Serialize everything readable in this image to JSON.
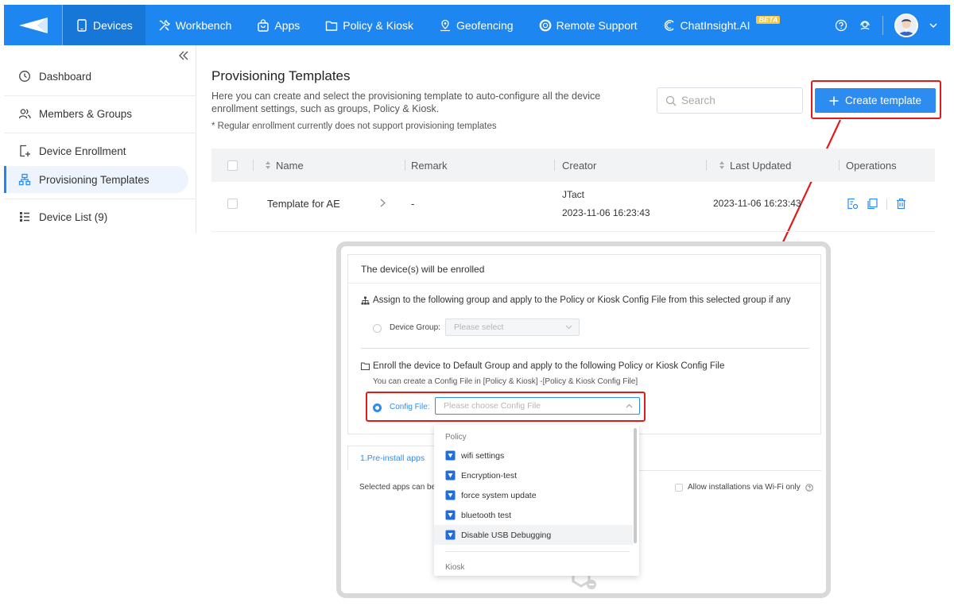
{
  "nav": {
    "items": [
      {
        "label": "Devices",
        "icon": "tablet-icon",
        "active": true
      },
      {
        "label": "Workbench",
        "icon": "tools-icon"
      },
      {
        "label": "Apps",
        "icon": "bag-icon"
      },
      {
        "label": "Policy & Kiosk",
        "icon": "folder-icon"
      },
      {
        "label": "Geofencing",
        "icon": "location-icon"
      },
      {
        "label": "Remote Support",
        "icon": "lifebuoy-icon"
      },
      {
        "label": "ChatInsight.AI",
        "icon": "chat-ai-icon"
      }
    ],
    "beta_badge": "BETA",
    "colors": {
      "bar": "#1e86f0",
      "active": "#1677d9"
    }
  },
  "sidebar": {
    "items": [
      {
        "label": "Dashboard",
        "icon": "dashboard-icon"
      },
      {
        "label": "Members & Groups",
        "icon": "members-icon"
      },
      {
        "label": "Device Enrollment",
        "icon": "enrollment-icon"
      },
      {
        "label": "Provisioning Templates",
        "icon": "templates-icon",
        "active": true
      },
      {
        "label": "Device List (9)",
        "icon": "list-icon"
      }
    ]
  },
  "main": {
    "title": "Provisioning Templates",
    "description": "Here you can create and select the provisioning template to auto-configure all the device enrollment settings, such as groups, Policy & Kiosk.",
    "note": "* Regular enrollment currently does not support provisioning templates",
    "search_placeholder": "Search",
    "create_label": "Create template",
    "columns": [
      "Name",
      "Remark",
      "Creator",
      "Last Updated",
      "Operations"
    ],
    "rows": [
      {
        "name": "Template for AE",
        "remark": "-",
        "creator": "JTact",
        "created": "2023-11-06 16:23:43",
        "updated": "2023-11-06 16:23:43"
      }
    ]
  },
  "zoom": {
    "section_title": "The device(s) will be enrolled",
    "assign_text": "Assign to the following group and apply to the Policy or Kiosk Config File from this selected group if any",
    "device_group_label": "Device Group:",
    "device_group_placeholder": "Please select",
    "default_text": "Enroll the device to Default Group and apply to the following Policy or Kiosk Config File",
    "config_hint": "You can create a Config File in [Policy & Kiosk] -[Policy & Kiosk Config File]",
    "config_label": "Config File:",
    "config_placeholder": "Please choose Config File",
    "tab_label": "1.Pre-install apps",
    "selected_apps_text": "Selected apps can be",
    "wifi_label": "Allow installations via Wi-Fi only",
    "dropdown": {
      "policy_group": "Policy",
      "kiosk_group": "Kiosk",
      "items": [
        "wifi settings",
        "Encryption-test",
        "force system update",
        "bluetooth test",
        "Disable USB Debugging"
      ],
      "hover_index": 4
    }
  },
  "colors": {
    "primary": "#2d8cf0",
    "highlight": "#e01b1b"
  }
}
